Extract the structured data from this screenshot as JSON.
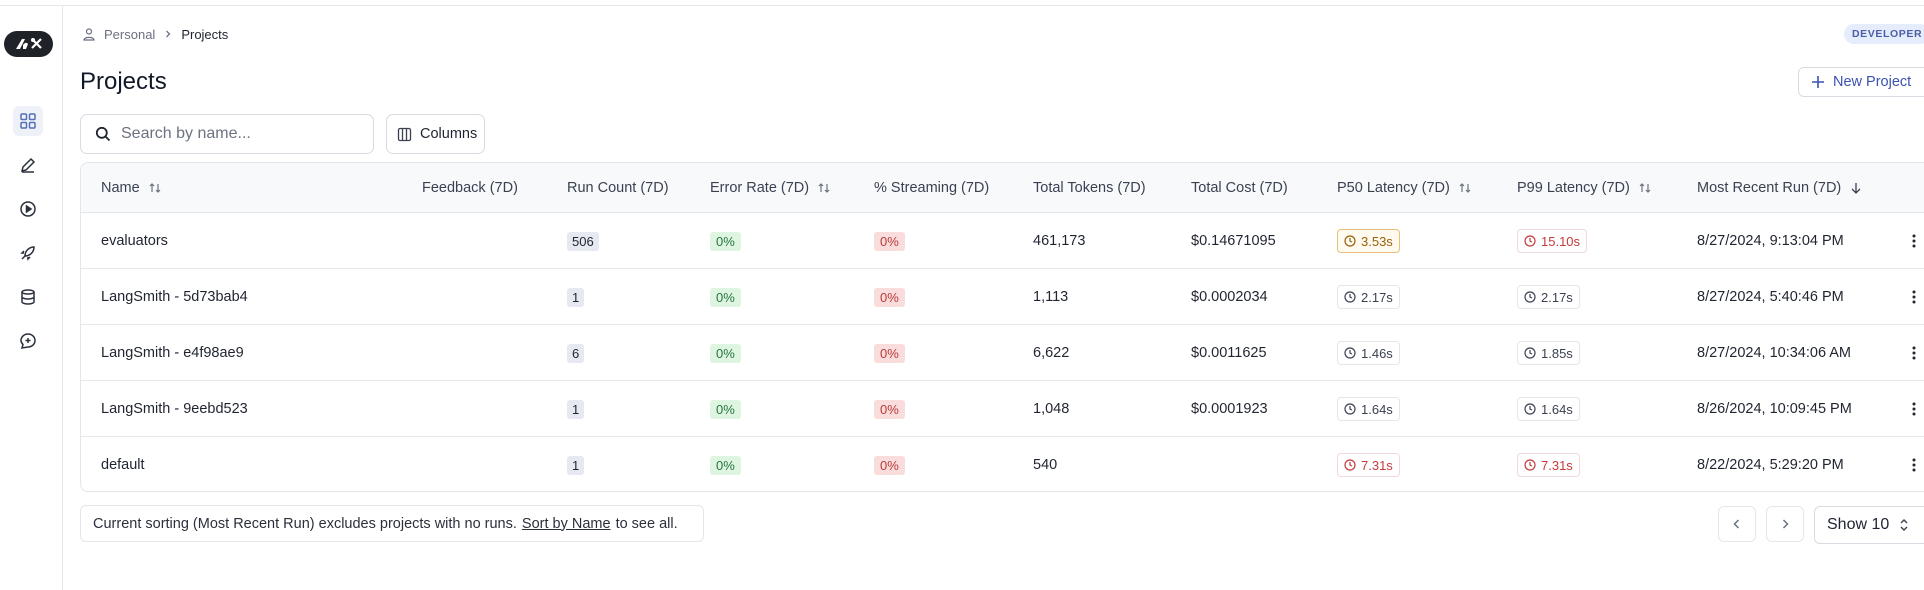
{
  "breadcrumb": {
    "parent": "Personal",
    "current": "Projects"
  },
  "badge": "DEVELOPER",
  "page_title": "Projects",
  "new_project_label": "New Project",
  "search": {
    "placeholder": "Search by name...",
    "value": ""
  },
  "columns_label": "Columns",
  "table": {
    "headers": {
      "name": "Name",
      "feedback": "Feedback (7D)",
      "run_count": "Run Count (7D)",
      "error_rate": "Error Rate (7D)",
      "streaming": "% Streaming (7D)",
      "total_tokens": "Total Tokens (7D)",
      "total_cost": "Total Cost (7D)",
      "p50": "P50 Latency (7D)",
      "p99": "P99 Latency (7D)",
      "recent": "Most Recent Run (7D)"
    },
    "rows": [
      {
        "name": "evaluators",
        "run_count": "506",
        "error_rate": "0%",
        "streaming": "0%",
        "total_tokens": "461,173",
        "total_cost": "$0.14671095",
        "p50": "3.53s",
        "p99": "15.10s",
        "recent": "8/27/2024, 9:13:04 PM"
      },
      {
        "name": "LangSmith - 5d73bab4",
        "run_count": "1",
        "error_rate": "0%",
        "streaming": "0%",
        "total_tokens": "1,113",
        "total_cost": "$0.0002034",
        "p50": "2.17s",
        "p99": "2.17s",
        "recent": "8/27/2024, 5:40:46 PM"
      },
      {
        "name": "LangSmith - e4f98ae9",
        "run_count": "6",
        "error_rate": "0%",
        "streaming": "0%",
        "total_tokens": "6,622",
        "total_cost": "$0.0011625",
        "p50": "1.46s",
        "p99": "1.85s",
        "recent": "8/27/2024, 10:34:06 AM"
      },
      {
        "name": "LangSmith - 9eebd523",
        "run_count": "1",
        "error_rate": "0%",
        "streaming": "0%",
        "total_tokens": "1,048",
        "total_cost": "$0.0001923",
        "p50": "1.64s",
        "p99": "1.64s",
        "recent": "8/26/2024, 10:09:45 PM"
      },
      {
        "name": "default",
        "run_count": "1",
        "error_rate": "0%",
        "streaming": "0%",
        "total_tokens": "540",
        "total_cost": "",
        "p50": "7.31s",
        "p99": "7.31s",
        "recent": "8/22/2024, 5:29:20 PM"
      }
    ]
  },
  "footer": {
    "note_prefix": "Current sorting (Most Recent Run) excludes projects with no runs.",
    "note_link": "Sort by Name",
    "note_suffix": "to see all.",
    "show_label": "Show 10"
  },
  "colors": {
    "accent": "#3b52b0",
    "success": "#26773a",
    "danger": "#b93b3b",
    "warning": "#9b5f0b"
  }
}
